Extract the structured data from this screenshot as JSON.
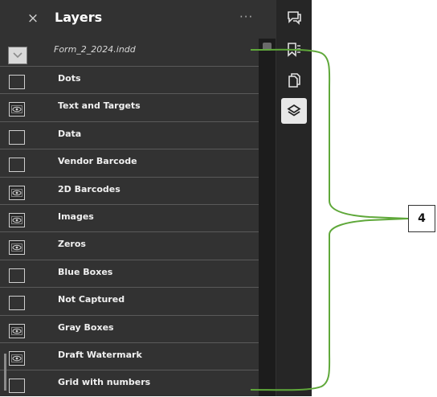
{
  "panel": {
    "close_glyph": "×",
    "title": "Layers",
    "more_glyph": "···",
    "document_name": "Form_2_2024.indd"
  },
  "layers": [
    {
      "name": "Dots",
      "visible": false
    },
    {
      "name": "Text and Targets",
      "visible": true
    },
    {
      "name": "Data",
      "visible": false
    },
    {
      "name": "Vendor Barcode",
      "visible": false
    },
    {
      "name": "2D Barcodes",
      "visible": true
    },
    {
      "name": "Images",
      "visible": true
    },
    {
      "name": "Zeros",
      "visible": true
    },
    {
      "name": "Blue Boxes",
      "visible": false
    },
    {
      "name": "Not Captured",
      "visible": false
    },
    {
      "name": "Gray Boxes",
      "visible": true
    },
    {
      "name": "Draft Watermark",
      "visible": true
    },
    {
      "name": "Grid with numbers",
      "visible": false
    }
  ],
  "rail": [
    "comments-icon",
    "bookmarks-icon",
    "pages-icon",
    "layers-icon"
  ],
  "callout": {
    "label": "4"
  },
  "colors": {
    "panel_bg": "#323232",
    "bracket": "#5fa83a",
    "text": "#f0f0f0"
  }
}
